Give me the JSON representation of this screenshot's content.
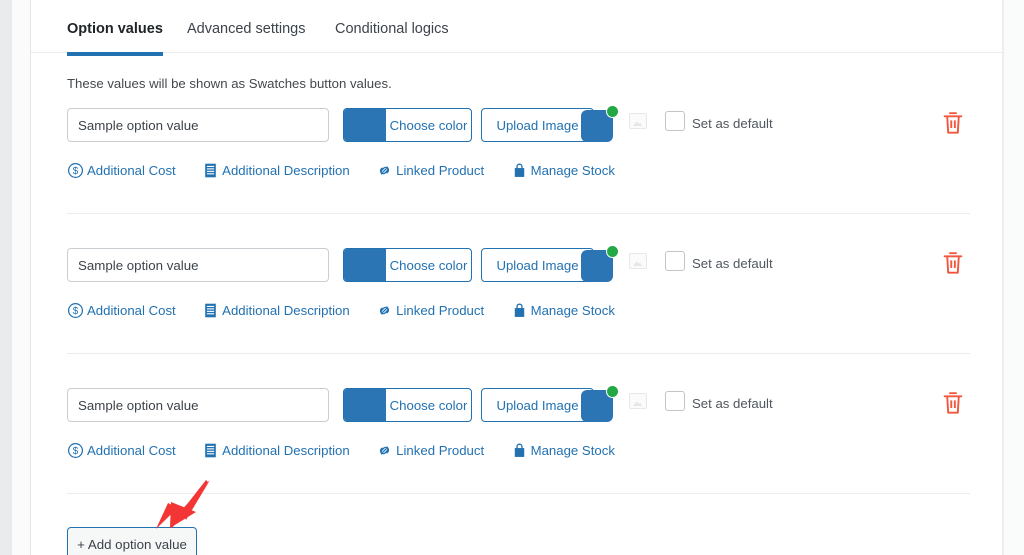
{
  "tabs": [
    {
      "label": "Option values",
      "active": true
    },
    {
      "label": "Advanced settings",
      "active": false
    },
    {
      "label": "Conditional logics",
      "active": false
    }
  ],
  "description": "These values will be shown as Swatches button values.",
  "row_controls": {
    "value_input_value": "Sample option value",
    "value_input_placeholder": "Sample option value",
    "choose_color_label": "Choose color",
    "choose_color_swatch": "#2c75b5",
    "upload_image_label": "Upload Image",
    "preview_swatch_color": "#2c75b5",
    "preview_badge_color": "#22a844",
    "set_as_default_label": "Set as default",
    "set_as_default_checked": false,
    "delete_icon": "trash-icon",
    "delete_icon_color": "#f2563f"
  },
  "row_links": [
    {
      "label": "Additional Cost",
      "icon": "dollar-circle-icon"
    },
    {
      "label": "Additional Description",
      "icon": "document-lines-icon"
    },
    {
      "label": "Linked Product",
      "icon": "chain-link-icon"
    },
    {
      "label": "Manage Stock",
      "icon": "shopping-bag-icon"
    }
  ],
  "rows": [
    {
      "index": 1
    },
    {
      "index": 2
    },
    {
      "index": 3
    }
  ],
  "add_option_button": {
    "label": "+ Add option value"
  },
  "annotation": {
    "arrow_color": "#f43535",
    "points_to": "add-option-value-button"
  },
  "theme": {
    "accent": "#2271b1",
    "text": "#3c434a",
    "border": "#c9ced3",
    "card_bg": "#ffffff",
    "page_bg": "#eceef0"
  }
}
